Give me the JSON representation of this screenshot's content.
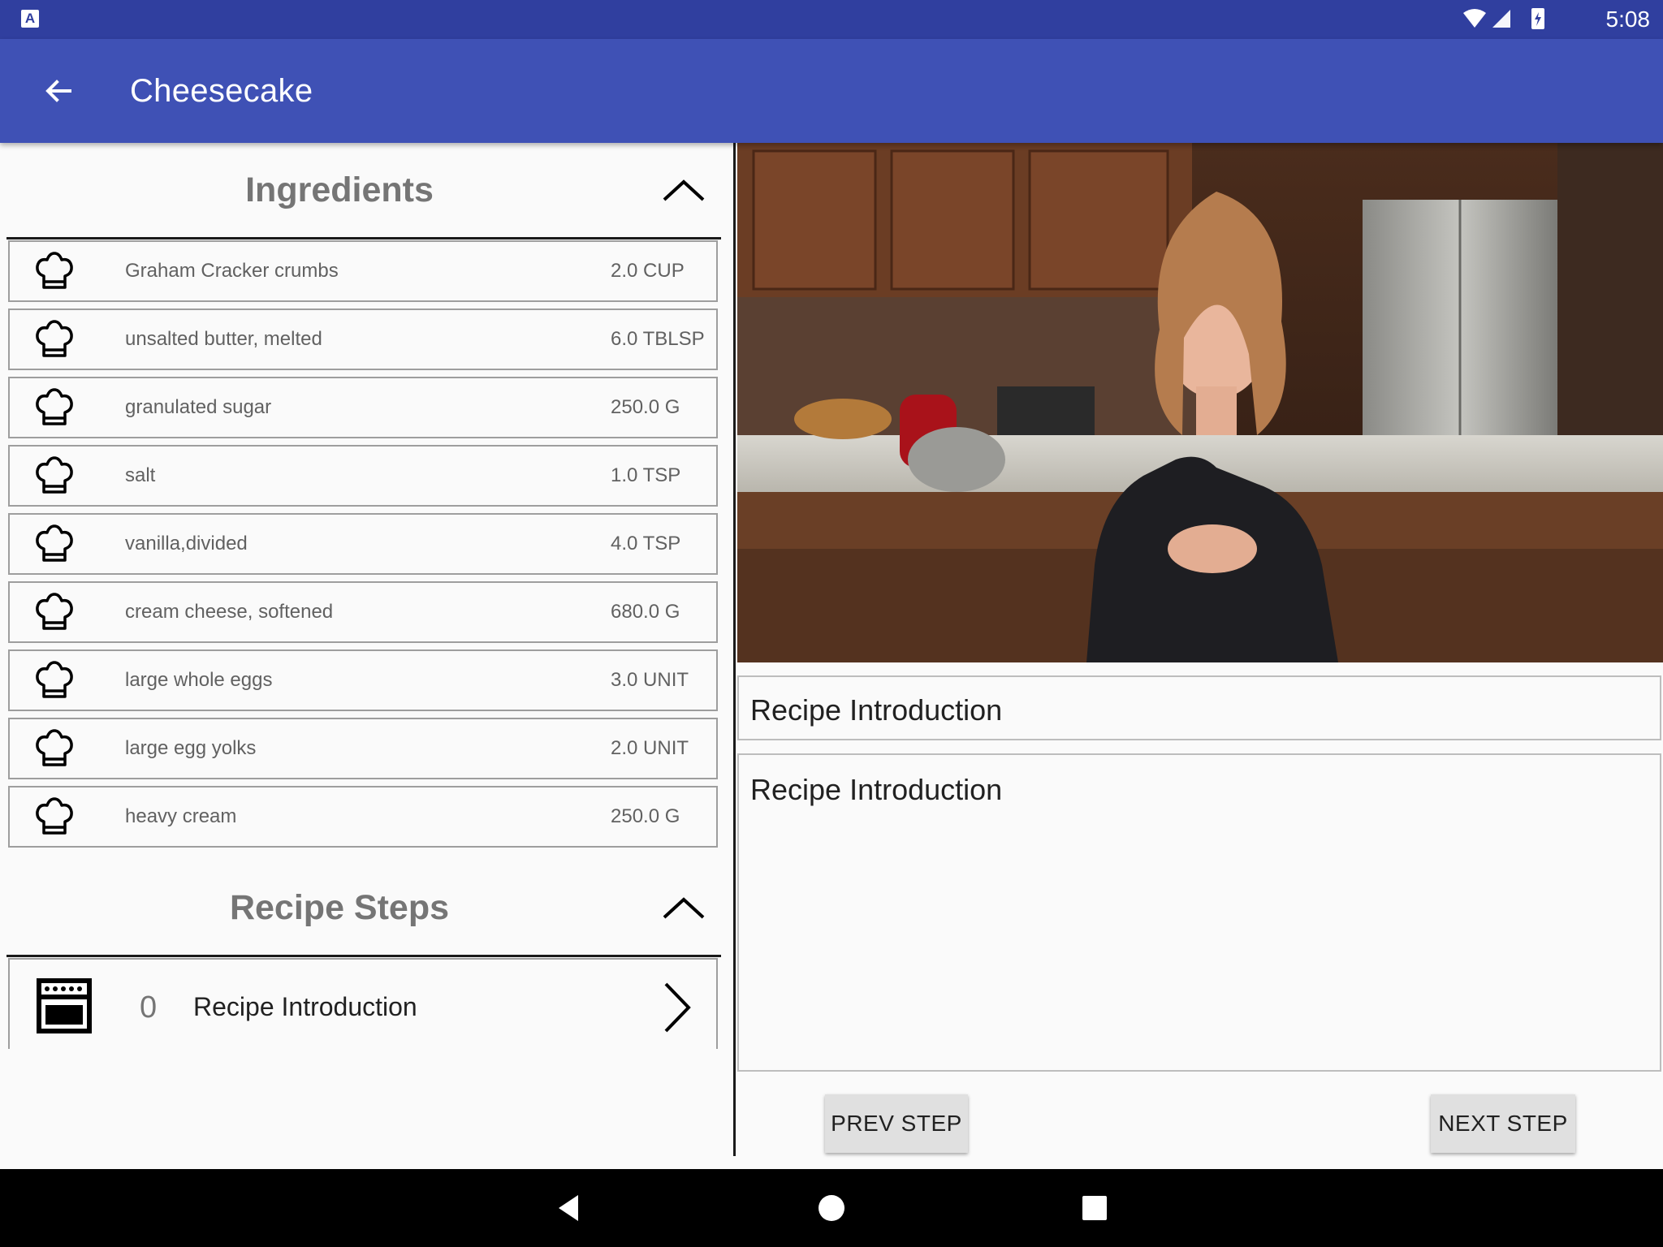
{
  "status_bar": {
    "time": "5:08",
    "app_badge": "A"
  },
  "app_bar": {
    "title": "Cheesecake",
    "back_icon": "arrow-back-icon"
  },
  "ingredients_section": {
    "title": "Ingredients",
    "collapse_icon": "chevron-up-icon",
    "items": [
      {
        "name": "Graham Cracker crumbs",
        "quantity": "2.0 CUP"
      },
      {
        "name": "unsalted butter, melted",
        "quantity": "6.0 TBLSP"
      },
      {
        "name": "granulated sugar",
        "quantity": "250.0 G"
      },
      {
        "name": "salt",
        "quantity": "1.0 TSP"
      },
      {
        "name": "vanilla,divided",
        "quantity": "4.0 TSP"
      },
      {
        "name": "cream cheese, softened",
        "quantity": "680.0 G"
      },
      {
        "name": "large whole eggs",
        "quantity": "3.0 UNIT"
      },
      {
        "name": "large egg yolks",
        "quantity": "2.0 UNIT"
      },
      {
        "name": "heavy cream",
        "quantity": "250.0 G"
      }
    ]
  },
  "steps_section": {
    "title": "Recipe Steps",
    "collapse_icon": "chevron-up-icon",
    "items": [
      {
        "number": "0",
        "label": "Recipe Introduction"
      }
    ]
  },
  "step_detail": {
    "short_description": "Recipe Introduction",
    "description": "Recipe Introduction",
    "prev_label": "PREV STEP",
    "next_label": "NEXT STEP"
  },
  "colors": {
    "status_bar": "#303f9f",
    "app_bar": "#3f51b5",
    "button": "#e0e0e0"
  }
}
